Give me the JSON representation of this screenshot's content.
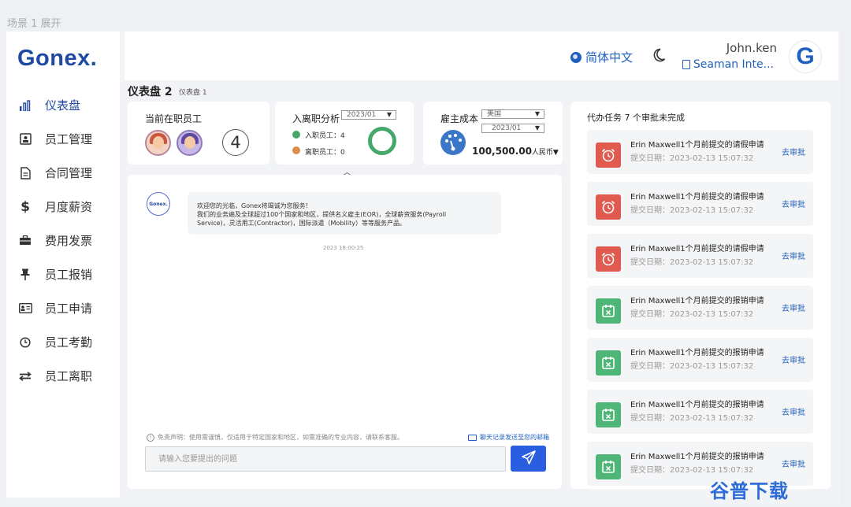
{
  "scene": {
    "label": "场景 1 展开"
  },
  "brand": {
    "logo": "Gonex."
  },
  "sidebar": {
    "items": [
      {
        "label": "仪表盘",
        "icon": "bar-chart-icon",
        "active": true
      },
      {
        "label": "员工管理",
        "icon": "id-card-icon"
      },
      {
        "label": "合同管理",
        "icon": "document-icon"
      },
      {
        "label": "月度薪资",
        "icon": "dollar-icon"
      },
      {
        "label": "费用发票",
        "icon": "briefcase-icon"
      },
      {
        "label": "员工报销",
        "icon": "pin-icon"
      },
      {
        "label": "员工申请",
        "icon": "badge-icon"
      },
      {
        "label": "员工考勤",
        "icon": "clock-icon"
      },
      {
        "label": "员工离职",
        "icon": "transfer-icon"
      }
    ]
  },
  "header": {
    "language": "简体中文",
    "user_name": "John.ken",
    "company": "Seaman Inte...",
    "avatar_letter": "G"
  },
  "page": {
    "title": "仪表盘 2",
    "subtitle": "仪表盘 1"
  },
  "cards": {
    "employees": {
      "title": "当前在职员工",
      "count": "4"
    },
    "onboarding": {
      "title": "入离职分析",
      "period": "2023/01",
      "joined_label": "入职员工：4",
      "left_label": "离职员工：0",
      "colors": {
        "joined": "#45a86a",
        "left": "#d9914a"
      }
    },
    "cost": {
      "title": "雇主成本",
      "country": "美国",
      "period": "2023/01",
      "value": "100,500.00",
      "currency": "人民币▼"
    }
  },
  "chat": {
    "bot_name": "Gonex.",
    "lines": [
      "欢迎您的光临，Gonex将竭诚为您服务！",
      "我们的业务遍及全球超过100个国家和地区，提供名义雇主(EOR)，全球薪资服务(Payroll",
      "Service)，灵活用工(Contractor)，国际派遣（Mobility）等等服务产品。"
    ],
    "time": "2023 18:00:25",
    "disclaimer": "免责声明：使用需谨慎，仅适用于特定国家和地区，如需准确的专业内容，请联系客服。",
    "email_link": "聊天记录发送至您的邮箱",
    "input_placeholder": "请输入您要提出的问题"
  },
  "tasks": {
    "title": "代办任务 7 个审批未完成",
    "action_label": "去审批",
    "items": [
      {
        "title": "Erin Maxwell1个月前提交的请假申请",
        "date": "提交日期：2023-02-13 15:07:32",
        "kind": "leave",
        "color": "#e05a4f"
      },
      {
        "title": "Erin Maxwell1个月前提交的请假申请",
        "date": "提交日期：2023-02-13 15:07:32",
        "kind": "leave",
        "color": "#e05a4f"
      },
      {
        "title": "Erin Maxwell1个月前提交的请假申请",
        "date": "提交日期：2023-02-13 15:07:32",
        "kind": "leave",
        "color": "#e05a4f"
      },
      {
        "title": "Erin Maxwell1个月前提交的报销申请",
        "date": "提交日期：2023-02-13 15:07:32",
        "kind": "expense",
        "color": "#4fb678"
      },
      {
        "title": "Erin Maxwell1个月前提交的报销申请",
        "date": "提交日期：2023-02-13 15:07:32",
        "kind": "expense",
        "color": "#4fb678"
      },
      {
        "title": "Erin Maxwell1个月前提交的报销申请",
        "date": "提交日期：2023-02-13 15:07:32",
        "kind": "expense",
        "color": "#4fb678"
      },
      {
        "title": "Erin Maxwell1个月前提交的报销申请",
        "date": "提交日期：2023-02-13 15:07:32",
        "kind": "expense",
        "color": "#4fb678"
      }
    ]
  },
  "watermark": {
    "text": "谷普下载"
  }
}
